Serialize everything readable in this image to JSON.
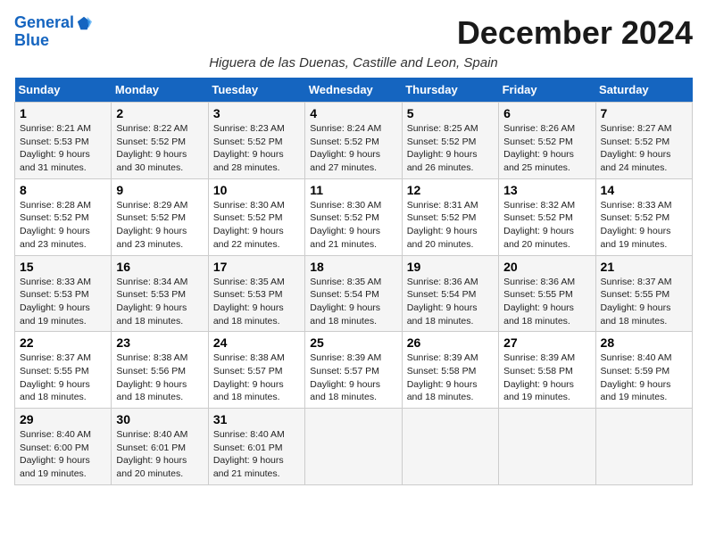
{
  "logo": {
    "line1": "General",
    "line2": "Blue"
  },
  "title": "December 2024",
  "subtitle": "Higuera de las Duenas, Castille and Leon, Spain",
  "days_of_week": [
    "Sunday",
    "Monday",
    "Tuesday",
    "Wednesday",
    "Thursday",
    "Friday",
    "Saturday"
  ],
  "weeks": [
    [
      {
        "day": "1",
        "sunrise": "8:21 AM",
        "sunset": "5:53 PM",
        "daylight": "9 hours and 31 minutes."
      },
      {
        "day": "2",
        "sunrise": "8:22 AM",
        "sunset": "5:52 PM",
        "daylight": "9 hours and 30 minutes."
      },
      {
        "day": "3",
        "sunrise": "8:23 AM",
        "sunset": "5:52 PM",
        "daylight": "9 hours and 28 minutes."
      },
      {
        "day": "4",
        "sunrise": "8:24 AM",
        "sunset": "5:52 PM",
        "daylight": "9 hours and 27 minutes."
      },
      {
        "day": "5",
        "sunrise": "8:25 AM",
        "sunset": "5:52 PM",
        "daylight": "9 hours and 26 minutes."
      },
      {
        "day": "6",
        "sunrise": "8:26 AM",
        "sunset": "5:52 PM",
        "daylight": "9 hours and 25 minutes."
      },
      {
        "day": "7",
        "sunrise": "8:27 AM",
        "sunset": "5:52 PM",
        "daylight": "9 hours and 24 minutes."
      }
    ],
    [
      {
        "day": "8",
        "sunrise": "8:28 AM",
        "sunset": "5:52 PM",
        "daylight": "9 hours and 23 minutes."
      },
      {
        "day": "9",
        "sunrise": "8:29 AM",
        "sunset": "5:52 PM",
        "daylight": "9 hours and 23 minutes."
      },
      {
        "day": "10",
        "sunrise": "8:30 AM",
        "sunset": "5:52 PM",
        "daylight": "9 hours and 22 minutes."
      },
      {
        "day": "11",
        "sunrise": "8:30 AM",
        "sunset": "5:52 PM",
        "daylight": "9 hours and 21 minutes."
      },
      {
        "day": "12",
        "sunrise": "8:31 AM",
        "sunset": "5:52 PM",
        "daylight": "9 hours and 20 minutes."
      },
      {
        "day": "13",
        "sunrise": "8:32 AM",
        "sunset": "5:52 PM",
        "daylight": "9 hours and 20 minutes."
      },
      {
        "day": "14",
        "sunrise": "8:33 AM",
        "sunset": "5:52 PM",
        "daylight": "9 hours and 19 minutes."
      }
    ],
    [
      {
        "day": "15",
        "sunrise": "8:33 AM",
        "sunset": "5:53 PM",
        "daylight": "9 hours and 19 minutes."
      },
      {
        "day": "16",
        "sunrise": "8:34 AM",
        "sunset": "5:53 PM",
        "daylight": "9 hours and 18 minutes."
      },
      {
        "day": "17",
        "sunrise": "8:35 AM",
        "sunset": "5:53 PM",
        "daylight": "9 hours and 18 minutes."
      },
      {
        "day": "18",
        "sunrise": "8:35 AM",
        "sunset": "5:54 PM",
        "daylight": "9 hours and 18 minutes."
      },
      {
        "day": "19",
        "sunrise": "8:36 AM",
        "sunset": "5:54 PM",
        "daylight": "9 hours and 18 minutes."
      },
      {
        "day": "20",
        "sunrise": "8:36 AM",
        "sunset": "5:55 PM",
        "daylight": "9 hours and 18 minutes."
      },
      {
        "day": "21",
        "sunrise": "8:37 AM",
        "sunset": "5:55 PM",
        "daylight": "9 hours and 18 minutes."
      }
    ],
    [
      {
        "day": "22",
        "sunrise": "8:37 AM",
        "sunset": "5:55 PM",
        "daylight": "9 hours and 18 minutes."
      },
      {
        "day": "23",
        "sunrise": "8:38 AM",
        "sunset": "5:56 PM",
        "daylight": "9 hours and 18 minutes."
      },
      {
        "day": "24",
        "sunrise": "8:38 AM",
        "sunset": "5:57 PM",
        "daylight": "9 hours and 18 minutes."
      },
      {
        "day": "25",
        "sunrise": "8:39 AM",
        "sunset": "5:57 PM",
        "daylight": "9 hours and 18 minutes."
      },
      {
        "day": "26",
        "sunrise": "8:39 AM",
        "sunset": "5:58 PM",
        "daylight": "9 hours and 18 minutes."
      },
      {
        "day": "27",
        "sunrise": "8:39 AM",
        "sunset": "5:58 PM",
        "daylight": "9 hours and 19 minutes."
      },
      {
        "day": "28",
        "sunrise": "8:40 AM",
        "sunset": "5:59 PM",
        "daylight": "9 hours and 19 minutes."
      }
    ],
    [
      {
        "day": "29",
        "sunrise": "8:40 AM",
        "sunset": "6:00 PM",
        "daylight": "9 hours and 19 minutes."
      },
      {
        "day": "30",
        "sunrise": "8:40 AM",
        "sunset": "6:01 PM",
        "daylight": "9 hours and 20 minutes."
      },
      {
        "day": "31",
        "sunrise": "8:40 AM",
        "sunset": "6:01 PM",
        "daylight": "9 hours and 21 minutes."
      },
      null,
      null,
      null,
      null
    ]
  ]
}
